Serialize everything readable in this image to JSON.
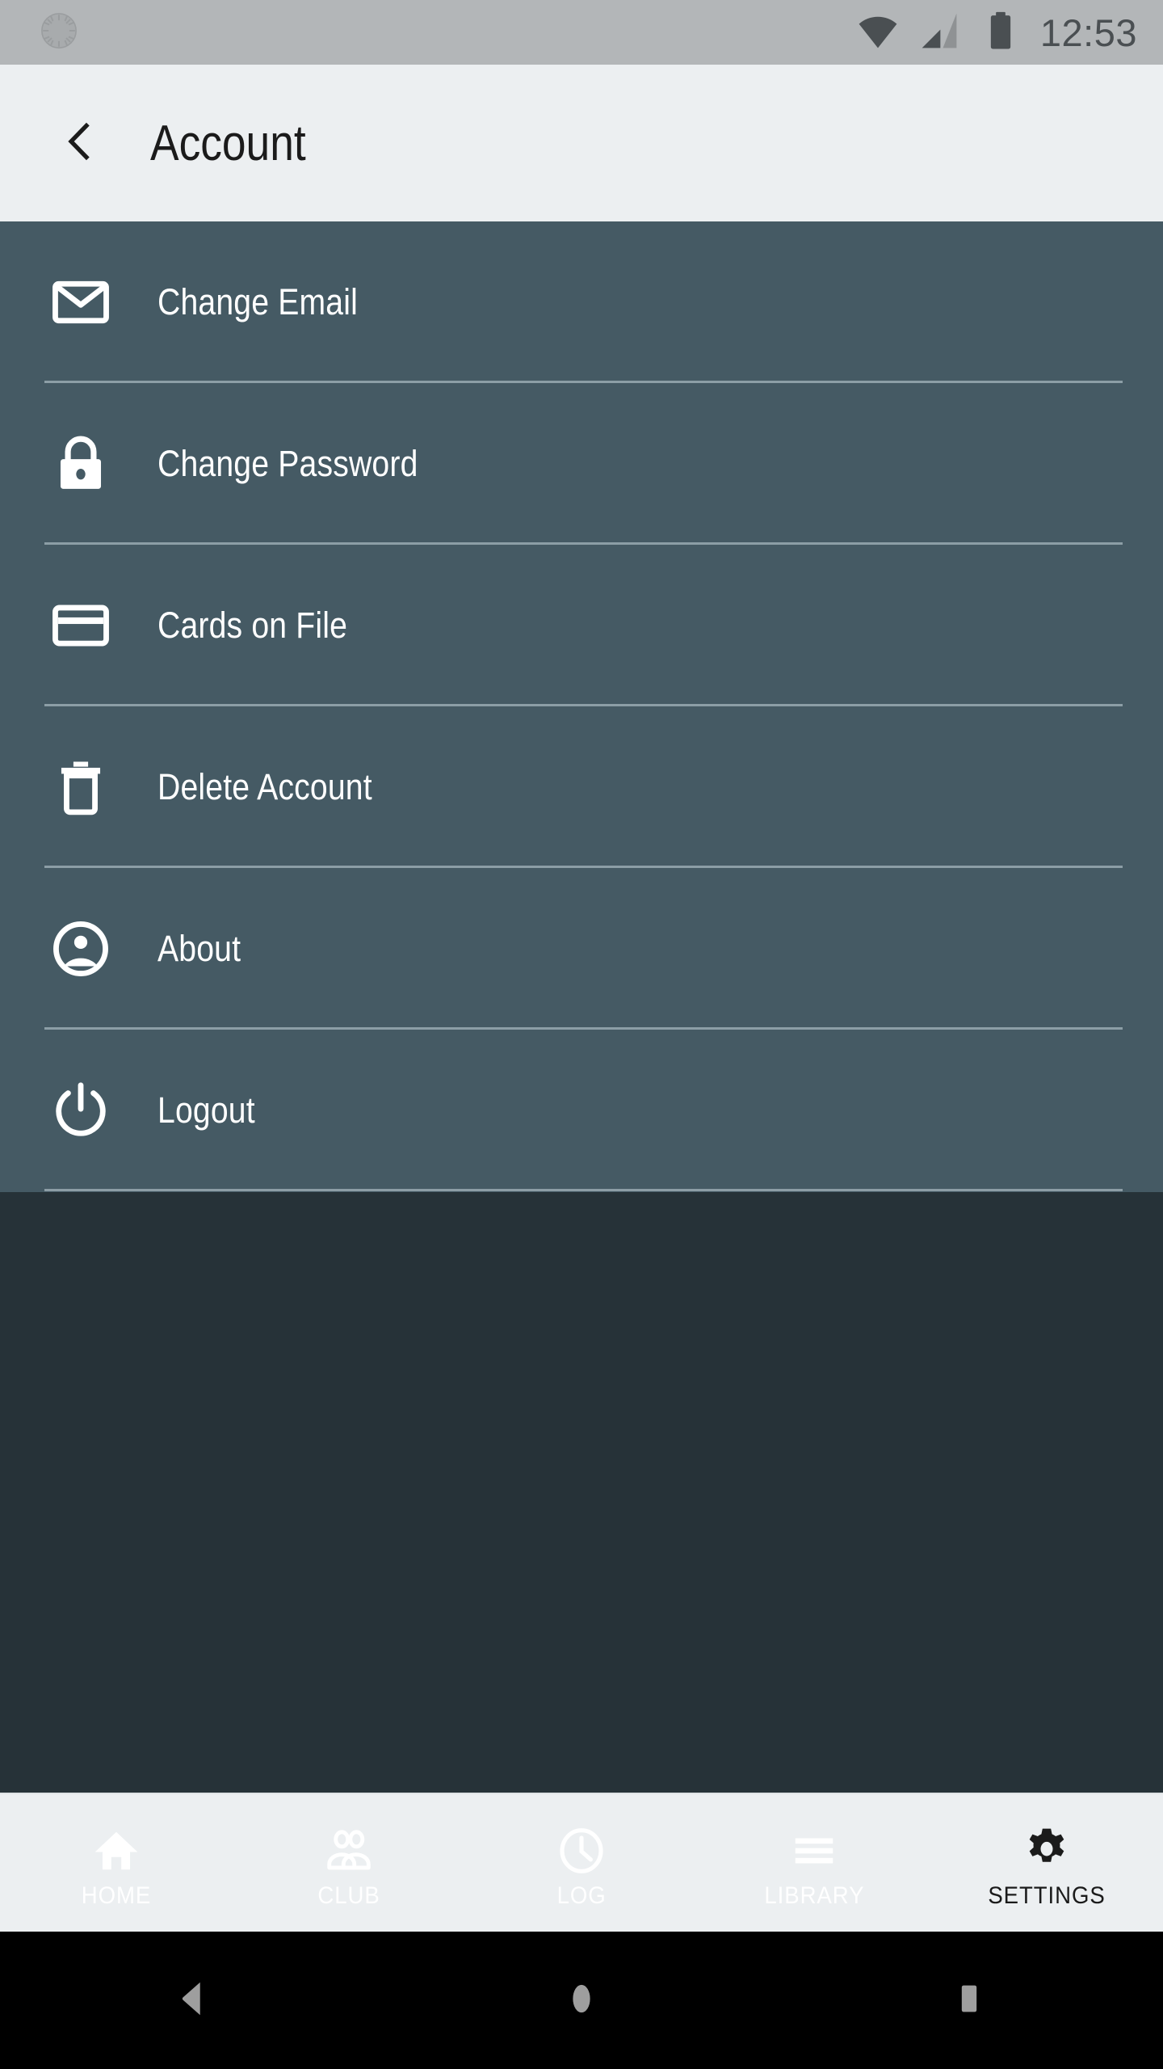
{
  "status_bar": {
    "time": "12:53",
    "left_icon": "sunburst-circle-icon",
    "icons": [
      "wifi-icon",
      "cellular-signal-icon",
      "battery-full-icon"
    ],
    "background_color": "#b3b6b8",
    "foreground_color": "#4a4f52"
  },
  "header": {
    "title": "Account",
    "back_icon": "chevron-left-icon",
    "background_color": "#eceff1",
    "text_color": "#1b1b1b"
  },
  "list": {
    "background_color": "#455a64",
    "text_color": "#ffffff",
    "divider_color": "#8c9ea6",
    "items": [
      {
        "label": "Change Email",
        "icon": "envelope-icon"
      },
      {
        "label": "Change Password",
        "icon": "lock-icon"
      },
      {
        "label": "Cards on File",
        "icon": "credit-card-icon"
      },
      {
        "label": "Delete Account",
        "icon": "trash-icon"
      },
      {
        "label": "About",
        "icon": "account-circle-icon"
      },
      {
        "label": "Logout",
        "icon": "power-icon"
      }
    ]
  },
  "page_background_color": "#263238",
  "bottom_nav": {
    "background_color": "#eceff1",
    "active_color": "#1b1b1b",
    "inactive_color": "#ffffff",
    "tabs": [
      {
        "label": "HOME",
        "icon": "home-icon",
        "active": false
      },
      {
        "label": "CLUB",
        "icon": "people-icon",
        "active": false
      },
      {
        "label": "LOG",
        "icon": "clock-icon",
        "active": false
      },
      {
        "label": "LIBRARY",
        "icon": "menu-icon",
        "active": false
      },
      {
        "label": "SETTINGS",
        "icon": "gear-icon",
        "active": true
      }
    ]
  },
  "android_nav": {
    "background_color": "#000000",
    "icon_color": "#9e9e9e",
    "buttons": [
      {
        "name": "back",
        "icon": "triangle-left-icon"
      },
      {
        "name": "home",
        "icon": "circle-icon"
      },
      {
        "name": "recents",
        "icon": "square-icon"
      }
    ]
  }
}
